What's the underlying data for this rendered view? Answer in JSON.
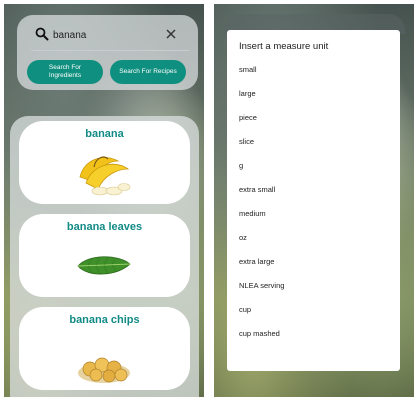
{
  "left_screen": {
    "search": {
      "value": "banana",
      "placeholder": ""
    },
    "buttons": {
      "ingredients": "Search For Ingredients",
      "recipes": "Search For Recipes"
    },
    "results": [
      {
        "title": "banana"
      },
      {
        "title": "banana leaves"
      },
      {
        "title": "banana chips"
      }
    ]
  },
  "right_screen": {
    "dialog": {
      "title": "Insert a measure unit",
      "units": [
        "small",
        "large",
        "piece",
        "slice",
        "g",
        "extra small",
        "medium",
        "oz",
        "extra large",
        "NLEA serving",
        "cup",
        "cup mashed"
      ]
    }
  },
  "colors": {
    "accent": "#0f8f7f",
    "result_title": "#128b86"
  },
  "icons": [
    "search-icon",
    "close-icon",
    "banana-image",
    "banana-leaf-image",
    "banana-chips-image"
  ]
}
